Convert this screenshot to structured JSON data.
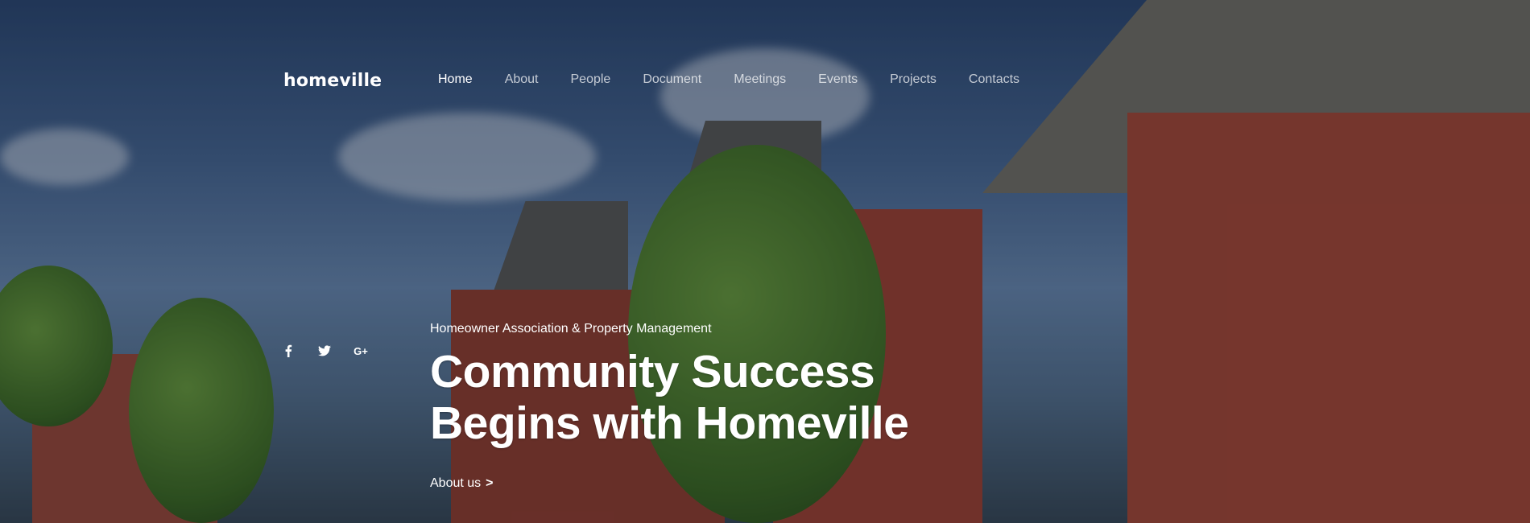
{
  "brand": {
    "name": "homeville"
  },
  "nav": {
    "items": [
      {
        "label": "Home",
        "active": true
      },
      {
        "label": "About"
      },
      {
        "label": "People"
      },
      {
        "label": "Document"
      },
      {
        "label": "Meetings"
      },
      {
        "label": "Events"
      },
      {
        "label": "Projects"
      },
      {
        "label": "Contacts"
      }
    ]
  },
  "social": {
    "icons": [
      {
        "name": "facebook-icon",
        "glyph": "f"
      },
      {
        "name": "twitter-icon",
        "glyph": "🐦"
      },
      {
        "name": "google-plus-icon",
        "glyph": "G+"
      }
    ]
  },
  "hero": {
    "subtitle": "Homeowner Association & Property Management",
    "headline_line1": "Community Success",
    "headline_line2": "Begins with Homeville",
    "cta_label": "About us",
    "cta_arrow": ">"
  },
  "colors": {
    "text": "#ffffff",
    "nav_inactive": "rgba(255,255,255,0.72)"
  }
}
